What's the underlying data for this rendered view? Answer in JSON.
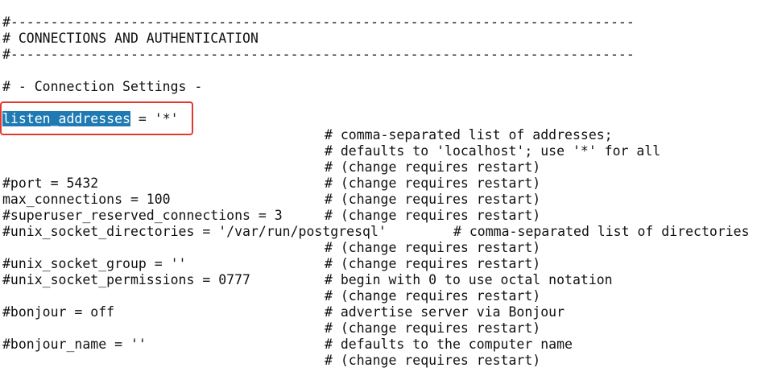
{
  "editor": {
    "selection_color": "#1f7ab3",
    "annotation_color": "#e23b2e",
    "header": {
      "rule_top": "#------------------------------------------------------------------------------",
      "title": "# CONNECTIONS AND AUTHENTICATION",
      "rule_bottom": "#------------------------------------------------------------------------------"
    },
    "section_title": "# - Connection Settings -",
    "listen": {
      "key": "listen_addresses",
      "rest": " = '*'"
    },
    "comments": {
      "listen_1": "# comma-separated list of addresses;",
      "listen_2": "# defaults to 'localhost'; use '*' for all",
      "listen_3": "# (change requires restart)",
      "port": "# (change requires restart)",
      "max_connections": "# (change requires restart)",
      "superuser": "# (change requires restart)",
      "unix_socket_dirs": "# comma-separated list of directories",
      "unix_socket_dirs_2": "# (change requires restart)",
      "unix_socket_group": "# (change requires restart)",
      "unix_socket_perms": "# begin with 0 to use octal notation",
      "unix_socket_perms_2": "# (change requires restart)",
      "bonjour": "# advertise server via Bonjour",
      "bonjour_2": "# (change requires restart)",
      "bonjour_name": "# defaults to the computer name",
      "bonjour_name_2": "# (change requires restart)"
    },
    "settings": {
      "port": "#port = 5432",
      "max_connections": "max_connections = 100",
      "superuser": "#superuser_reserved_connections = 3",
      "unix_socket_dirs": "#unix_socket_directories = '/var/run/postgresql'",
      "unix_socket_group": "#unix_socket_group = ''",
      "unix_socket_perms": "#unix_socket_permissions = 0777",
      "bonjour": "#bonjour = off",
      "bonjour_name": "#bonjour_name = ''"
    }
  }
}
